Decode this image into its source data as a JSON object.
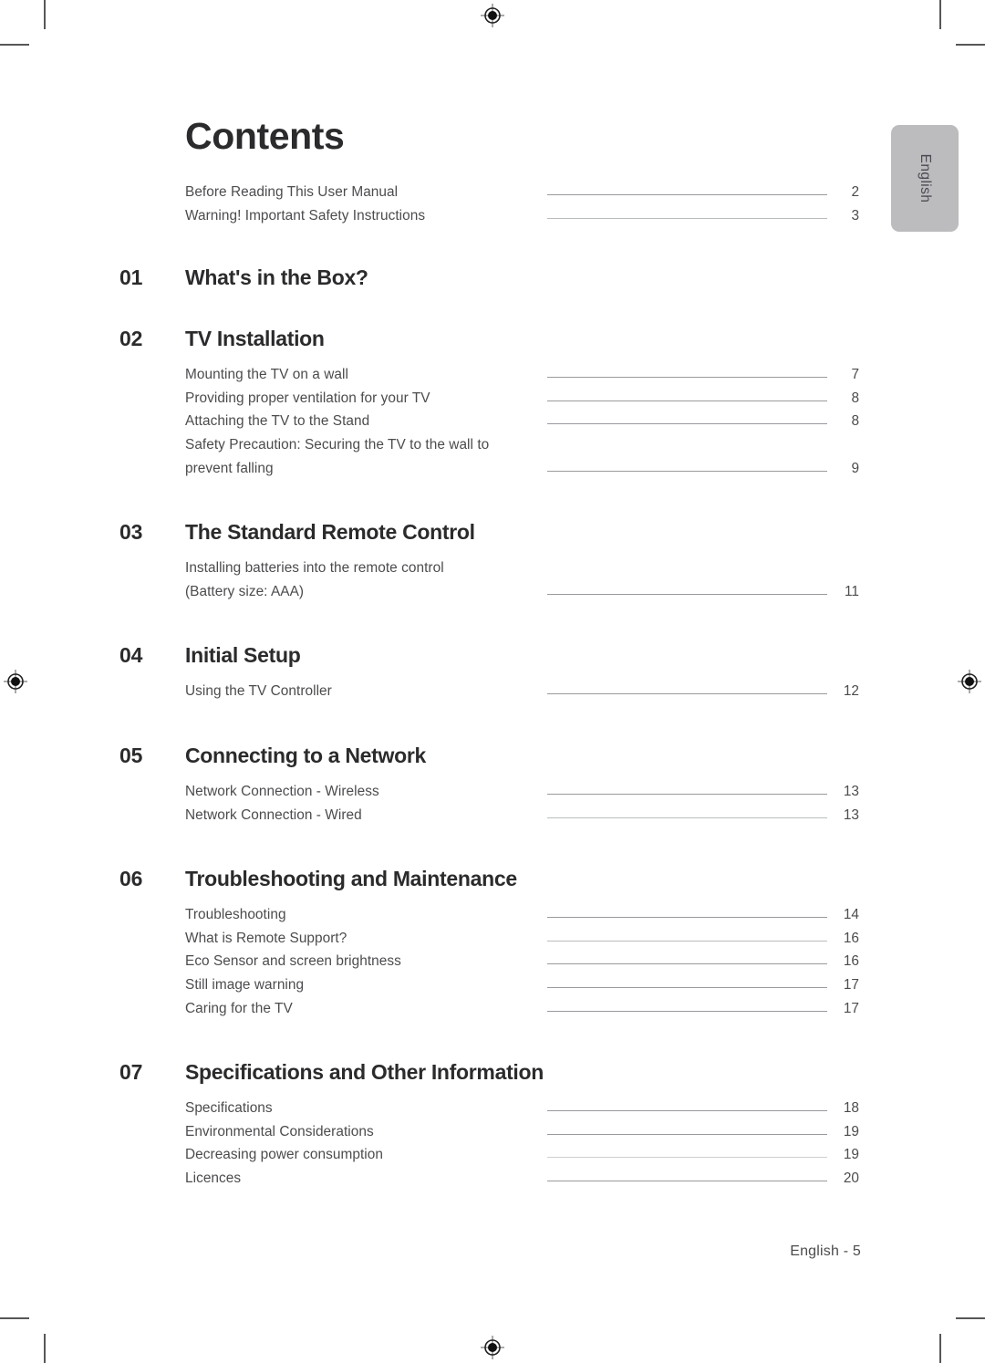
{
  "document": {
    "page_title": "Contents",
    "side_tab_label": "English",
    "footer": "English - 5"
  },
  "intro_entries": [
    {
      "label": "Before Reading This User Manual",
      "page": "2",
      "leader": "normal"
    },
    {
      "label": "Warning! Important Safety Instructions",
      "page": "3",
      "leader": "faint"
    }
  ],
  "chapters": [
    {
      "number": "01",
      "title": "What's in the Box?",
      "entries": []
    },
    {
      "number": "02",
      "title": "TV Installation",
      "entries": [
        {
          "label": "Mounting the TV on a wall",
          "page": "7",
          "leader": "normal"
        },
        {
          "label": "Providing proper ventilation for your TV",
          "page": "8",
          "leader": "normal"
        },
        {
          "label": "Attaching the TV to the Stand",
          "page": "8",
          "leader": "normal"
        },
        {
          "label": "Safety Precaution: Securing the TV to the wall to",
          "page": "",
          "leader": "none"
        },
        {
          "label": "prevent falling",
          "page": "9",
          "leader": "normal"
        }
      ]
    },
    {
      "number": "03",
      "title": "The Standard Remote Control",
      "entries": [
        {
          "label": "Installing batteries into the remote control",
          "page": "",
          "leader": "none"
        },
        {
          "label": "(Battery size: AAA)",
          "page": "11",
          "leader": "normal"
        }
      ]
    },
    {
      "number": "04",
      "title": "Initial Setup",
      "entries": [
        {
          "label": "Using the TV Controller",
          "page": "12",
          "leader": "normal"
        }
      ]
    },
    {
      "number": "05",
      "title": "Connecting to a Network",
      "entries": [
        {
          "label": "Network Connection - Wireless",
          "page": "13",
          "leader": "normal"
        },
        {
          "label": "Network Connection - Wired",
          "page": "13",
          "leader": "faint"
        }
      ]
    },
    {
      "number": "06",
      "title": "Troubleshooting and Maintenance",
      "entries": [
        {
          "label": "Troubleshooting",
          "page": "14",
          "leader": "normal"
        },
        {
          "label": "What is Remote Support?",
          "page": "16",
          "leader": "faint"
        },
        {
          "label": "Eco Sensor and screen brightness",
          "page": "16",
          "leader": "normal"
        },
        {
          "label": "Still image warning",
          "page": "17",
          "leader": "normal"
        },
        {
          "label": "Caring for the TV",
          "page": "17",
          "leader": "normal"
        }
      ]
    },
    {
      "number": "07",
      "title": "Specifications and Other Information",
      "entries": [
        {
          "label": "Specifications",
          "page": "18",
          "leader": "normal"
        },
        {
          "label": "Environmental Considerations",
          "page": "19",
          "leader": "normal"
        },
        {
          "label": "Decreasing power consumption",
          "page": "19",
          "leader": "faintest"
        },
        {
          "label": "Licences",
          "page": "20",
          "leader": "normal"
        }
      ]
    }
  ],
  "colors": {
    "heading": "#2b2a2c",
    "body_text": "#4c4b4e",
    "leader_line": "#9a9a9e",
    "side_tab_bg": "#bcbcbe",
    "trim_mark": "#575757"
  }
}
